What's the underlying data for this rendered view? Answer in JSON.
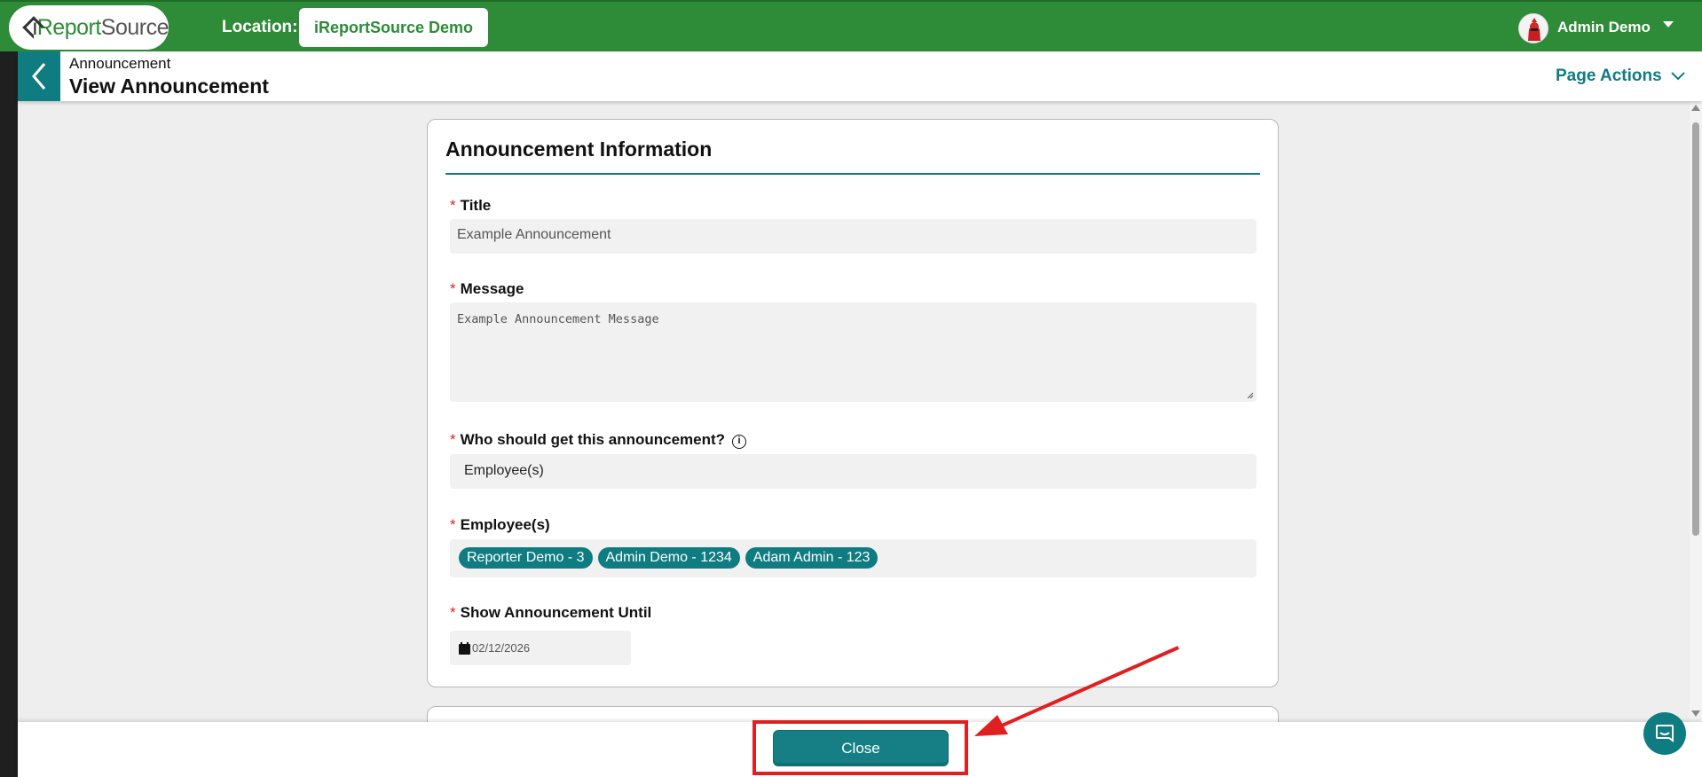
{
  "topbar": {
    "logo": {
      "part1": "i",
      "part2": "Report",
      "part3": "Source"
    },
    "location_label": "Location:",
    "location_value": "iReportSource Demo",
    "user_name": "Admin Demo"
  },
  "header": {
    "breadcrumb": "Announcement",
    "title": "View Announcement",
    "page_actions": "Page Actions"
  },
  "card": {
    "title": "Announcement Information",
    "required_marker": "*",
    "fields": {
      "title_label": "Title",
      "title_value": "Example Announcement",
      "message_label": "Message",
      "message_value": "Example Announcement Message",
      "who_label": "Who should get this announcement?",
      "who_info_icon": "i",
      "who_value": "Employee(s)",
      "employees_label": "Employee(s)",
      "employees": [
        "Reporter Demo - 3",
        "Admin Demo - 1234",
        "Adam Admin - 123"
      ],
      "show_until_label": "Show Announcement Until",
      "show_until_value": "02/12/2026"
    }
  },
  "footer": {
    "close_label": "Close"
  },
  "colors": {
    "brand_green": "#2e8b37",
    "teal": "#0f7c82",
    "highlight_red": "#e02020"
  },
  "icons": [
    "back-chevron-icon",
    "chevron-down-icon",
    "info-icon",
    "calendar-icon",
    "chat-icon",
    "user-avatar-icon"
  ]
}
